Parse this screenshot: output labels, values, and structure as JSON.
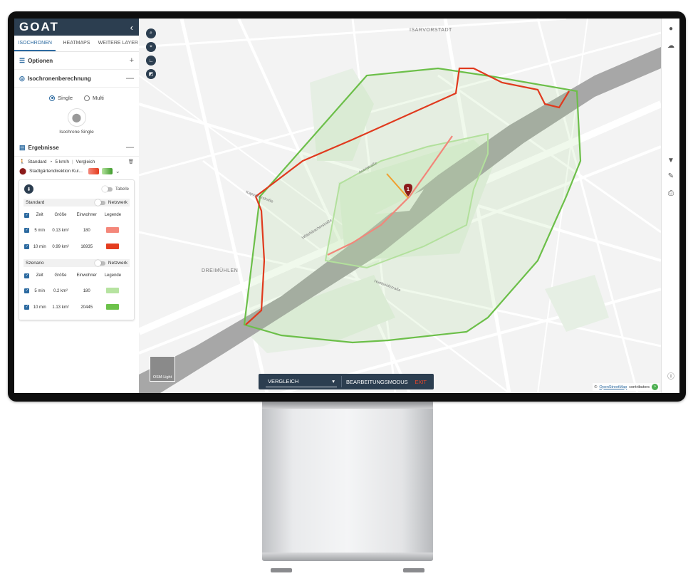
{
  "brand": {
    "logo": "GOAT",
    "collapse_icon": "chevron-left-icon"
  },
  "tabs": [
    {
      "label": "ISOCHRONEN",
      "active": true
    },
    {
      "label": "HEATMAPS",
      "active": false
    },
    {
      "label": "WEITERE LAYER",
      "active": false
    }
  ],
  "options": {
    "title": "Optionen",
    "control": "+"
  },
  "iso_calc": {
    "title": "Isochronenberechnung",
    "control": "—",
    "modes": [
      {
        "label": "Single",
        "selected": true
      },
      {
        "label": "Multi",
        "selected": false
      }
    ],
    "card_label": "Isochrone Single"
  },
  "results": {
    "title": "Ergebnisse",
    "control": "—",
    "profile": "Standard",
    "speed": "5 km/h",
    "mode": "Vergleich",
    "marker_number": "1",
    "location": "Stadtgärtendirektion Kul...",
    "tabelle_label": "Tabelle",
    "groups": [
      {
        "name": "Standard",
        "toggle_label": "Netzwerk",
        "headers": [
          "Zeit",
          "Größe",
          "Einwohner",
          "Legende"
        ],
        "rows": [
          {
            "time": "5 min",
            "size": "0.13 km²",
            "pop": "180",
            "color": "#f4877a"
          },
          {
            "time": "10 min",
            "size": "0.99 km²",
            "pop": "16935",
            "color": "#e43d1f"
          }
        ]
      },
      {
        "name": "Szenario",
        "toggle_label": "Netzwerk",
        "headers": [
          "Zeit",
          "Größe",
          "Einwohner",
          "Legende"
        ],
        "rows": [
          {
            "time": "5 min",
            "size": "0.2 km²",
            "pop": "180",
            "color": "#b6e3a0"
          },
          {
            "time": "10 min",
            "size": "1.13 km²",
            "pop": "20445",
            "color": "#6cc24a"
          }
        ]
      }
    ]
  },
  "map": {
    "labels": {
      "district1": "ISARVORSTADT",
      "district2": "DREIMÜHLEN",
      "street1": "Auenstraße",
      "street2": "Wittelsbacherstraße",
      "street3": "Kapuzinerstraße",
      "street4": "Humboldtstraße"
    },
    "basemap_label": "OSM-Light",
    "toolbar": {
      "select_value": "VERGLEICH",
      "edit_mode": "BEARBEITUNGSMODUS",
      "exit": "EXIT"
    },
    "attribution_prefix": "©",
    "attribution_link": "OpenStreetMap",
    "attribution_suffix": "contributors",
    "colors": {
      "standard_10": "#e03a1e",
      "standard_5": "#f2867a",
      "scenario_10": "#6cbf49",
      "scenario_5": "#b2e09c",
      "river": "#a9a9a9",
      "marker": "#8b1a1a"
    }
  },
  "rightbar_icons": [
    "user-icon",
    "cloud-icon",
    "filter-icon",
    "edit-icon",
    "print-icon",
    "info-icon"
  ]
}
